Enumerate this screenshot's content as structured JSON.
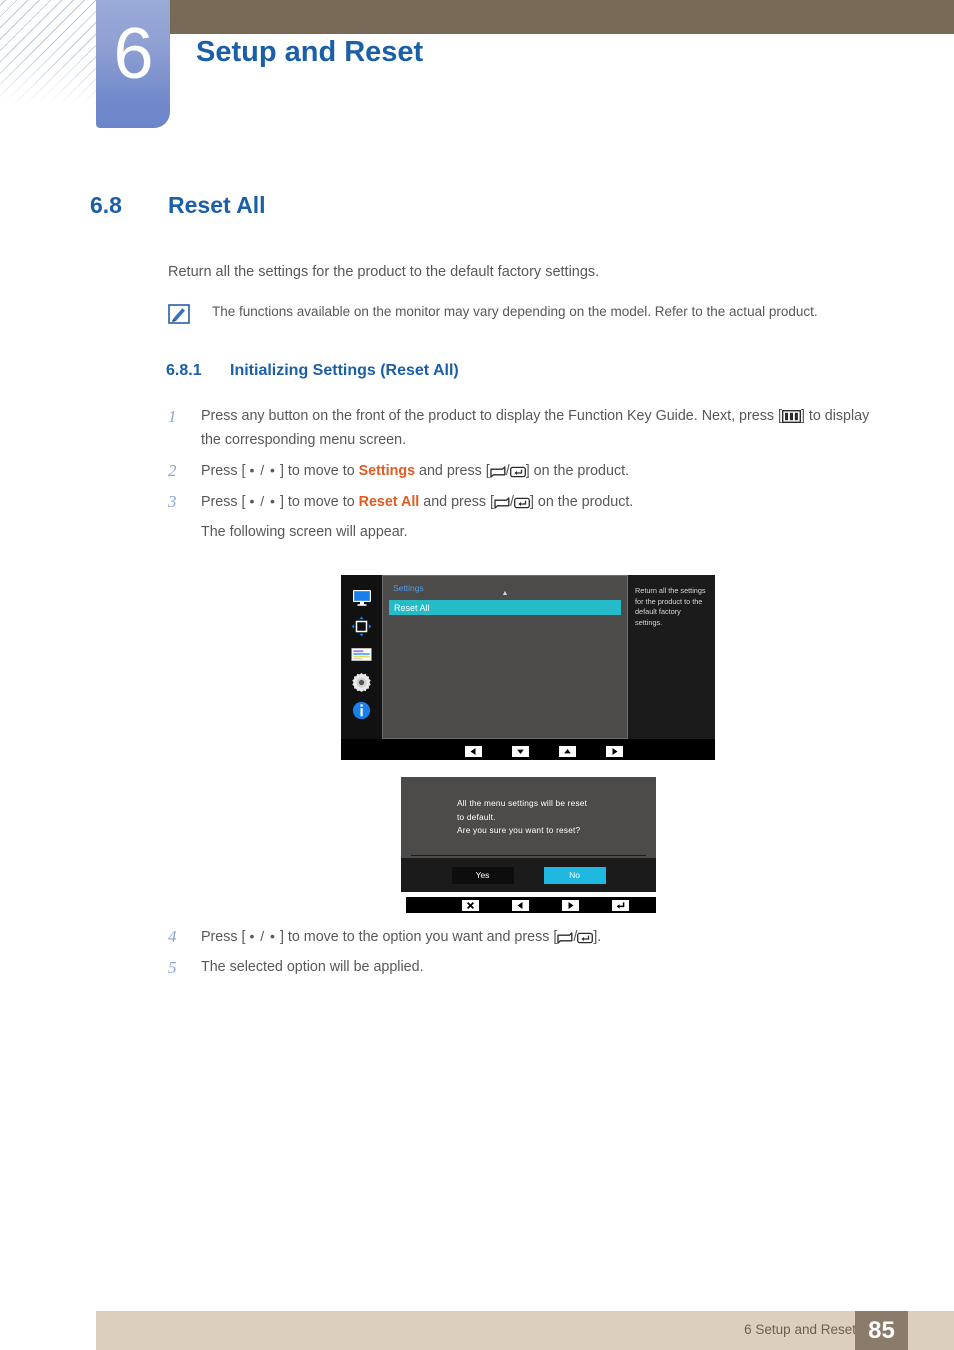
{
  "header": {
    "chapter_number": "6",
    "chapter_title": "Setup and Reset"
  },
  "section": {
    "number": "6.8",
    "title": "Reset All",
    "intro": "Return all the settings for the product to the default factory settings."
  },
  "note": {
    "icon": "note-pencil-icon",
    "text": "The functions available on the monitor may vary depending on the model. Refer to the actual product."
  },
  "subsection": {
    "number": "6.8.1",
    "title": "Initializing Settings (Reset All)"
  },
  "steps": [
    {
      "num": "1",
      "text_a": "Press any button on the front of the product to display the Function Key Guide. Next, press [",
      "text_b": "] to display the corresponding menu screen.",
      "icon": "menu-bars-key-icon"
    },
    {
      "num": "2",
      "text_a": "Press [",
      "dots": "• / •",
      "text_b": "] to move to ",
      "highlight": "Settings",
      "text_c": " and press [",
      "text_d": "] on the product."
    },
    {
      "num": "3",
      "text_a": "Press [",
      "dots": "• / •",
      "text_b": "] to move to ",
      "highlight": "Reset All",
      "text_c": " and press [",
      "text_d": "] on the product.",
      "sub": "The following screen will appear."
    },
    {
      "num": "4",
      "text_a": "Press [",
      "dots": "• / •",
      "text_b": "] to move to the option you want and press [",
      "text_d": "]."
    },
    {
      "num": "5",
      "text_a": "The selected option will be applied."
    }
  ],
  "osd_menu": {
    "sidebar_icons": [
      "monitor-icon",
      "picture-position-icon",
      "osd-display-icon",
      "settings-gear-icon",
      "information-icon"
    ],
    "category_label": "Settings",
    "selected_item": "Reset All",
    "description": "Return all the settings for the product to the default factory settings.",
    "key_guide": [
      "left-arrow-key",
      "down-arrow-key",
      "up-arrow-key",
      "right-arrow-key"
    ],
    "accent_color": "#23bcc8",
    "label_color": "#4d9ee6"
  },
  "osd_dialog": {
    "message_line1": "All the menu settings will be reset",
    "message_line2": "to default.",
    "message_line3": "Are you sure you want to reset?",
    "yes_label": "Yes",
    "no_label": "No",
    "selected_button": "No",
    "selected_color": "#1fb8e0",
    "key_guide": [
      "close-key",
      "left-arrow-key",
      "right-arrow-key",
      "enter-key"
    ]
  },
  "footer": {
    "label": "6 Setup and Reset",
    "page_number": "85"
  }
}
